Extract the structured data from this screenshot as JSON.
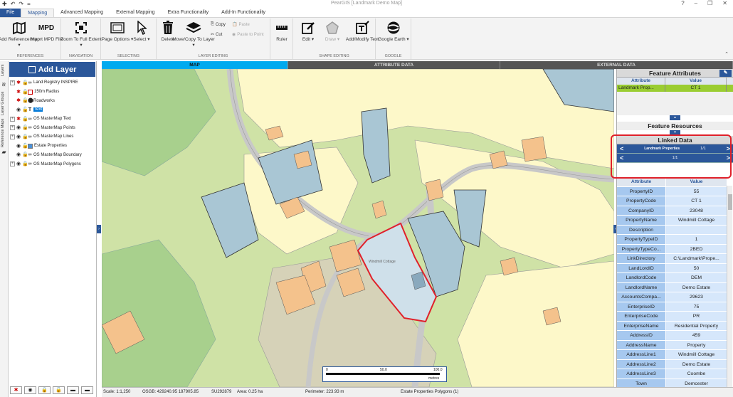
{
  "app": {
    "title": "PearGIS [Landmark Demo Map]",
    "qat": [
      "✚",
      "↶",
      "↷",
      "="
    ],
    "window_controls": [
      "?",
      "–",
      "❐",
      "✕"
    ]
  },
  "ribbon_tabs": [
    "File",
    "Mapping",
    "Advanced Mapping",
    "External Mapping",
    "Extra Functionality",
    "Add-In Functionality"
  ],
  "ribbon": {
    "references": {
      "label": "REFERENCES",
      "add_ref": "Add Reference Map ▾",
      "import_mpd": "Import MPD File",
      "mpd_icon": "MPD"
    },
    "navigation": {
      "label": "NAVIGATION",
      "zoom": "Zoom To Full Extent ▾"
    },
    "selecting": {
      "label": "SELECTING",
      "page_options": "Page Options ▾",
      "select": "Select ▾"
    },
    "layer_editing": {
      "label": "LAYER EDITING",
      "delete": "Delete",
      "move_copy": "Move/Copy To Layer ▾",
      "copy": "Copy",
      "paste": "Paste",
      "cut": "Cut",
      "paste_to_point": "Paste to Point"
    },
    "shape_editing": {
      "label": "SHAPE EDITING",
      "ruler": "Ruler",
      "edit": "Edit ▾",
      "draw": "Draw ▾",
      "add_modify_text": "Add/Modify Text"
    },
    "google": {
      "label": "GOOGLE",
      "google_earth": "Google Earth ▾"
    }
  },
  "side_tabs": [
    "Layers",
    "Layer Groups",
    "Reference Maps"
  ],
  "layers_panel": {
    "add_layer": "Add Layer",
    "layers": [
      {
        "name": "Land Registry INSPIRE",
        "expand": "+",
        "symbol": "link"
      },
      {
        "name": "150m Radius",
        "expand": "",
        "symbol": "square"
      },
      {
        "name": "Roadworks",
        "expand": "",
        "symbol": "marker"
      },
      {
        "name": "Text",
        "expand": "",
        "symbol": "text",
        "selected": true
      },
      {
        "name": "OS MasterMap Text",
        "expand": "+",
        "symbol": "link"
      },
      {
        "name": "OS MasterMap Points",
        "expand": "+",
        "symbol": "link"
      },
      {
        "name": "OS MasterMap Lines",
        "expand": "+",
        "symbol": "link"
      },
      {
        "name": "Estate Properties",
        "expand": "",
        "symbol": "fill"
      },
      {
        "name": "OS MasterMap Boundary",
        "expand": "",
        "symbol": "link"
      },
      {
        "name": "OS MasterMap Polygons",
        "expand": "+",
        "symbol": "link"
      }
    ]
  },
  "view_tabs": [
    "MAP",
    "ATTRIBUTE DATA",
    "EXTERNAL DATA"
  ],
  "map": {
    "polygon_label": "Windmill Cottage",
    "scalebar": {
      "ticks": [
        "0",
        "50.0",
        "100.0"
      ],
      "unit": "metres"
    }
  },
  "feature_attributes": {
    "title": "Feature Attributes",
    "col_attr": "Attribute",
    "col_value": "Value",
    "row": {
      "attribute": "Landmark Prop...",
      "value": "CT 1"
    }
  },
  "feature_resources": {
    "title": "Feature Resources"
  },
  "linked_data": {
    "title": "Linked Data",
    "nav1": {
      "label": "Landmark Properties",
      "count": "1/1"
    },
    "nav2": {
      "count": "1/1"
    },
    "col_attr": "Attribute",
    "col_value": "Value",
    "rows": [
      [
        "PropertyID",
        "55"
      ],
      [
        "PropertyCode",
        "CT 1"
      ],
      [
        "CompanyID",
        "23048"
      ],
      [
        "PropertyName",
        "Windmill Cottage"
      ],
      [
        "Description",
        ""
      ],
      [
        "PropertyTypeID",
        "1"
      ],
      [
        "PropertyTypeCo...",
        "2BED"
      ],
      [
        "LinkDirectory",
        "C:\\Landmark\\Prope..."
      ],
      [
        "LandLordID",
        "50"
      ],
      [
        "LandlordCode",
        "DEM"
      ],
      [
        "LandlordName",
        "Demo Estate"
      ],
      [
        "AccountsCompa...",
        "29623"
      ],
      [
        "EnterpriseID",
        "75"
      ],
      [
        "EnterpriseCode",
        "PR"
      ],
      [
        "EnterpriseName",
        "Residential Property"
      ],
      [
        "AddressID",
        "459"
      ],
      [
        "AddressName",
        "Property"
      ],
      [
        "AddressLine1",
        "Windmill Cottage"
      ],
      [
        "AddressLine2",
        "Demo Estate"
      ],
      [
        "AddressLine3",
        "Coombe"
      ],
      [
        "Town",
        "Demcester"
      ]
    ]
  },
  "status": {
    "scale": "Scale: 1:1,250",
    "osgb": "OSGB: 429240.95  187905.85",
    "grid": "SU292879",
    "area": "Area: 0.25 ha",
    "perimeter": "Perimeter: 223.93 m",
    "layer": "Estate Properties Polygons (1)"
  },
  "colors": {
    "accent": "#2b579a",
    "selection": "#9acd32",
    "map_tab": "#00aaef",
    "highlight": "#e0202a"
  }
}
